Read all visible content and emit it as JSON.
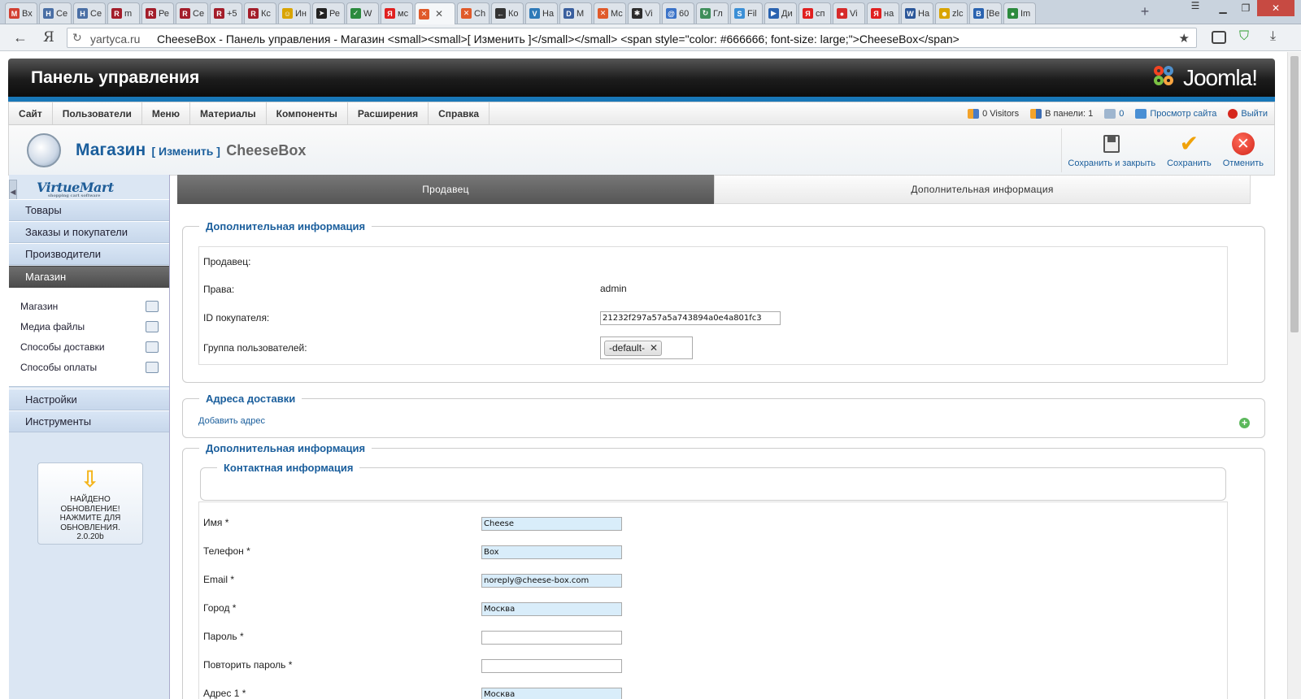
{
  "browser": {
    "tabs": [
      {
        "icon": "gmail-icon",
        "label": "Вх",
        "color": "#d23f31",
        "glyph": "M"
      },
      {
        "icon": "h-icon",
        "label": "Се",
        "color": "#4a6fa5",
        "glyph": "H"
      },
      {
        "icon": "h-icon",
        "label": "Се",
        "color": "#4a6fa5",
        "glyph": "H"
      },
      {
        "icon": "r-icon",
        "label": "m",
        "color": "#a31d2a",
        "glyph": "R"
      },
      {
        "icon": "r-icon",
        "label": "Ре",
        "color": "#a31d2a",
        "glyph": "R"
      },
      {
        "icon": "r-icon",
        "label": "Се",
        "color": "#a31d2a",
        "glyph": "R"
      },
      {
        "icon": "r-icon",
        "label": "+5",
        "color": "#a31d2a",
        "glyph": "R"
      },
      {
        "icon": "r-icon",
        "label": "Кс",
        "color": "#a31d2a",
        "glyph": "R"
      },
      {
        "icon": "smile-icon",
        "label": "Ин",
        "color": "#d9a400",
        "glyph": "☺"
      },
      {
        "icon": "arrow-icon",
        "label": "Ре",
        "color": "#222222",
        "glyph": "➤"
      },
      {
        "icon": "check-icon",
        "label": "W",
        "color": "#2b8a3e",
        "glyph": "✓"
      },
      {
        "icon": "yandex-icon",
        "label": "мс",
        "color": "#e02020",
        "glyph": "Я"
      },
      {
        "icon": "joomla-icon",
        "label": "",
        "color": "#e05a2a",
        "glyph": "✕",
        "active": true
      },
      {
        "icon": "joomla-icon",
        "label": "Ch",
        "color": "#e05a2a",
        "glyph": "✕"
      },
      {
        "icon": "back-icon",
        "label": "Ко",
        "color": "#333333",
        "glyph": "←"
      },
      {
        "icon": "vm-icon",
        "label": "На",
        "color": "#2e7ab8",
        "glyph": "V"
      },
      {
        "icon": "d-icon",
        "label": "М",
        "color": "#3a5f9e",
        "glyph": "D"
      },
      {
        "icon": "joomla-icon",
        "label": "Мс",
        "color": "#e05a2a",
        "glyph": "✕"
      },
      {
        "icon": "vm-color-icon",
        "label": "Vi",
        "color": "#2c2c2c",
        "glyph": "✱"
      },
      {
        "icon": "mail-icon",
        "label": "60",
        "color": "#3b73c8",
        "glyph": "@"
      },
      {
        "icon": "refresh-icon",
        "label": "Гл",
        "color": "#3e8e5a",
        "glyph": "↻"
      },
      {
        "icon": "s-icon",
        "label": "Fil",
        "color": "#3b8fd6",
        "glyph": "S"
      },
      {
        "icon": "play-icon",
        "label": "Ди",
        "color": "#2a63b0",
        "glyph": "▶"
      },
      {
        "icon": "yandex-icon",
        "label": "сп",
        "color": "#e02020",
        "glyph": "Я"
      },
      {
        "icon": "pin-icon",
        "label": "Vi",
        "color": "#d62b2b",
        "glyph": "●"
      },
      {
        "icon": "yandex-icon",
        "label": "на",
        "color": "#e02020",
        "glyph": "Я"
      },
      {
        "icon": "word-icon",
        "label": "На",
        "color": "#2a5699",
        "glyph": "W"
      },
      {
        "icon": "emoji-icon",
        "label": "zlc",
        "color": "#d9a400",
        "glyph": "☻"
      },
      {
        "icon": "b-icon",
        "label": "[Be",
        "color": "#2a63b0",
        "glyph": "B"
      },
      {
        "icon": "circle-icon",
        "label": "Im",
        "color": "#2c8a3e",
        "glyph": "●"
      }
    ],
    "url_host": "yartyca.ru",
    "url_title": "CheeseBox - Панель управления - Магазин <small><small>[ Изменить ]</small></small> <span style=\"color: #666666; font-size: large;\">CheeseBox</span>"
  },
  "header": {
    "title": "Панель управления",
    "logo_text": "Joomla!"
  },
  "menu": [
    "Сайт",
    "Пользователи",
    "Меню",
    "Материалы",
    "Компоненты",
    "Расширения",
    "Справка"
  ],
  "status": {
    "visitors": "0 Visitors",
    "admins": "В панели: 1",
    "messages": "0",
    "view_site": "Просмотр сайта",
    "logout": "Выйти"
  },
  "toolbar": {
    "title": "Магазин",
    "edit": "[ Изменить ]",
    "name": "CheeseBox",
    "save_close": "Сохранить и закрыть",
    "save": "Сохранить",
    "cancel": "Отменить"
  },
  "sidebar": {
    "logo": "VirtueMart",
    "logo_sub": "shopping cart software",
    "sections_top": [
      "Товары",
      "Заказы и покупатели",
      "Производители",
      "Магазин"
    ],
    "sub_items": [
      "Магазин",
      "Медиа файлы",
      "Способы доставки",
      "Способы оплаты"
    ],
    "sections_bottom": [
      "Настройки",
      "Инструменты"
    ],
    "update_lines": [
      "НАЙДЕНО",
      "ОБНОВЛЕНИЕ!",
      "НАЖМИТЕ ДЛЯ",
      "ОБНОВЛЕНИЯ.",
      "2.0.20b"
    ]
  },
  "tabs": {
    "seller": "Продавец",
    "extra": "Дополнительная информация"
  },
  "info": {
    "legend": "Дополнительная информация",
    "seller_label": "Продавец:",
    "rights_label": "Права:",
    "rights_value": "admin",
    "customer_id_label": "ID покупателя:",
    "customer_id_value": "21232f297a57a5a743894a0e4a801fc3",
    "group_label": "Группа пользователей:",
    "group_chip": "-default-"
  },
  "shipping": {
    "legend": "Адреса доставки",
    "add_link": "Добавить адрес"
  },
  "extra": {
    "legend": "Дополнительная информация",
    "contact_legend": "Контактная информация",
    "fields": [
      {
        "label": "Имя *",
        "value": "Cheese",
        "filled": true
      },
      {
        "label": "Телефон *",
        "value": "Box",
        "filled": true
      },
      {
        "label": "Email *",
        "value": "noreply@cheese-box.com",
        "filled": true
      },
      {
        "label": "Город *",
        "value": "Москва",
        "filled": true
      },
      {
        "label": "Пароль *",
        "value": "",
        "filled": false
      },
      {
        "label": "Повторить пароль *",
        "value": "",
        "filled": false
      },
      {
        "label": "Адрес 1 *",
        "value": "Москва",
        "filled": true
      }
    ]
  }
}
